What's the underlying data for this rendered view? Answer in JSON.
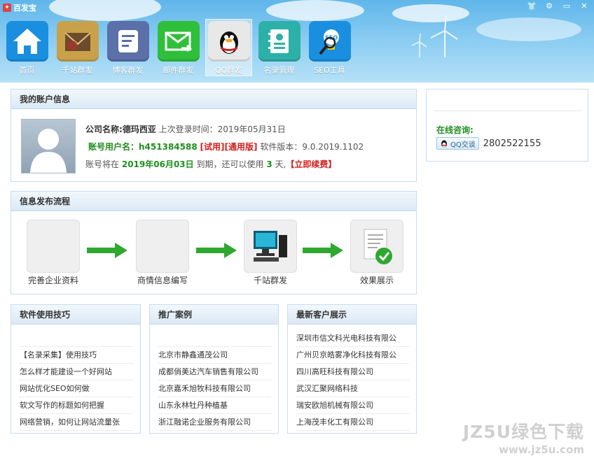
{
  "window": {
    "title": "百发宝",
    "controls": [
      "skin-icon",
      "gear-icon",
      "minimize-icon",
      "close-icon"
    ]
  },
  "nav": [
    {
      "label": "首页",
      "icon": "home-icon",
      "color": "#1a8fe0"
    },
    {
      "label": "千站群发",
      "icon": "envelope-stamp-icon",
      "color": "#c9a14a"
    },
    {
      "label": "博客群发",
      "icon": "blog-icon",
      "color": "#5b6fa8"
    },
    {
      "label": "邮件群发",
      "icon": "mail-forward-icon",
      "color": "#2fbf3a"
    },
    {
      "label": "QQ群发",
      "icon": "qq-penguin-icon",
      "color": "#e8e8e8",
      "active": true
    },
    {
      "label": "名录管理",
      "icon": "address-book-icon",
      "color": "#2db0a8"
    },
    {
      "label": "SEO工具",
      "icon": "seo-bulb-icon",
      "color": "#1a8fe0"
    }
  ],
  "account": {
    "header": "我的账户信息",
    "company_label": "公司名称:",
    "company_name": "德玛西亚",
    "last_login_label": "上次登录时间：",
    "last_login": "2019年05月31日",
    "user_label": "账号用户名：",
    "user_name": "h451384588",
    "tag_trial": "[试用]",
    "tag_general": "[通用版]",
    "version_label": "软件版本：",
    "version": "9.0.2019.1102",
    "expire_prefix": "账号将在",
    "expire_date": "2019年06月03日",
    "expire_mid": "到期，还可以使用",
    "days_left": "3",
    "days_unit": "天,",
    "renew": "【立即续费】"
  },
  "process": {
    "header": "信息发布流程",
    "steps": [
      {
        "label": "完善企业资料"
      },
      {
        "label": "商情信息编写"
      },
      {
        "label": "千站群发"
      },
      {
        "label": "效果展示"
      }
    ]
  },
  "tips": {
    "header": "软件使用技巧",
    "items": [
      "",
      "【名录采集】使用技巧",
      "怎么样才能建设一个好网站",
      "网站优化SEO如何做",
      "软文写作的标题如何把握",
      "网络营销，如何让网站流量张"
    ]
  },
  "cases": {
    "header": "推广案例",
    "items": [
      "",
      "北京市静鑫通茂公司",
      "成都俏美达汽车销售有限公司",
      "北京嘉禾旭牧科技有限公司",
      "山东永林牡丹种植基",
      "浙江融诺企业服务有限公司"
    ]
  },
  "clients": {
    "header": "最新客户展示",
    "items": [
      "深圳市信文科光电科技有限公",
      "广州贝京皓雾净化科技有限公",
      "四川高旺科技有限公司",
      "武汉汇聚网络科技",
      "瑞安欧旭机械有限公司",
      "上海茂丰化工有限公司"
    ]
  },
  "side": {
    "consult_label": "在线咨询:",
    "qq_button": "QQ交谈",
    "qq_number": "2802522155"
  },
  "watermark": {
    "line1": "JZ5U绿色下载",
    "line2": "www.jz5u.com"
  }
}
